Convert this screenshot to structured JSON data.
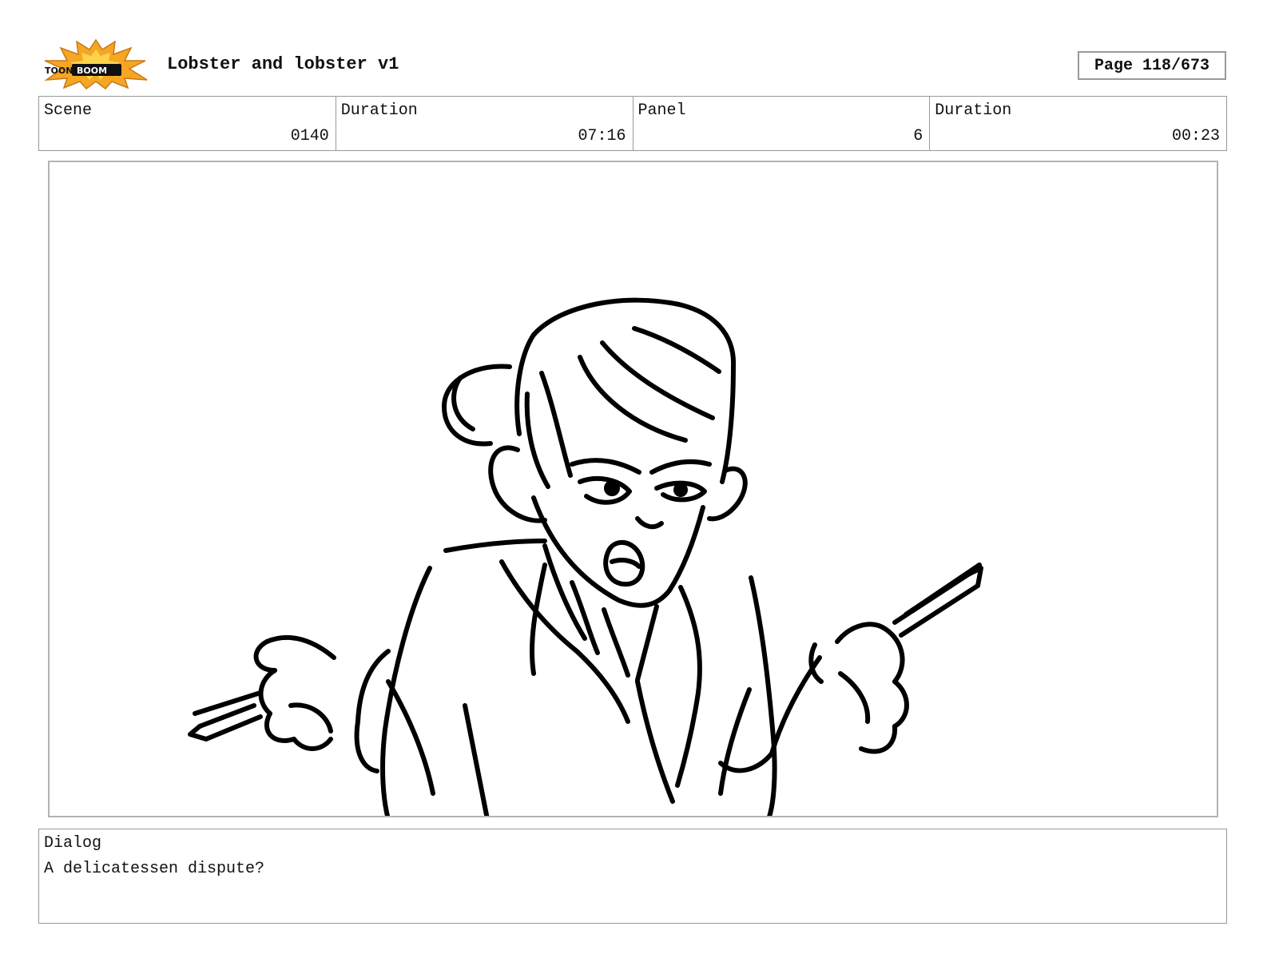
{
  "header": {
    "logo_text": "TOON BOOM",
    "title": "Lobster and lobster v1",
    "page": "Page 118/673"
  },
  "info": {
    "scene_label": "Scene",
    "scene_value": "0140",
    "scene_duration_label": "Duration",
    "scene_duration_value": "07:16",
    "panel_label": "Panel",
    "panel_value": "6",
    "panel_duration_label": "Duration",
    "panel_duration_value": "00:23"
  },
  "dialog": {
    "label": "Dialog",
    "text": "A delicatessen dispute?"
  }
}
